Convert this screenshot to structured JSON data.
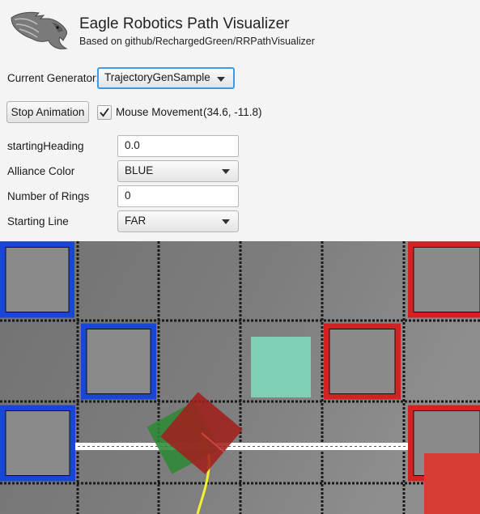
{
  "header": {
    "title": "Eagle Robotics Path Visualizer",
    "subtitle": "Based on github/RechargedGreen/RRPathVisualizer"
  },
  "generator": {
    "label": "Current Generator:",
    "value": "TrajectoryGenSample"
  },
  "animation": {
    "stop_label": "Stop Animation",
    "mouse_movement_label": "Mouse Movement",
    "mouse_movement_checked": true,
    "coordinates": "(34.6, -11.8)"
  },
  "params": [
    {
      "label": "startingHeading",
      "kind": "text",
      "value": "0.0"
    },
    {
      "label": "Alliance Color",
      "kind": "select",
      "value": "BLUE"
    },
    {
      "label": "Number of Rings",
      "kind": "text",
      "value": "0"
    },
    {
      "label": "Starting Line",
      "kind": "select",
      "value": "FAR"
    }
  ],
  "colors": {
    "field_gray": "#7b7b7b",
    "blue_alliance": "#1846d6",
    "red_alliance": "#d42222",
    "target_zone": "#7fcfb6",
    "robot_green": "#2e8a36",
    "robot_red": "#a0201c",
    "path_yellow": "#f5f032",
    "focus_ring": "#3d9ae8"
  }
}
